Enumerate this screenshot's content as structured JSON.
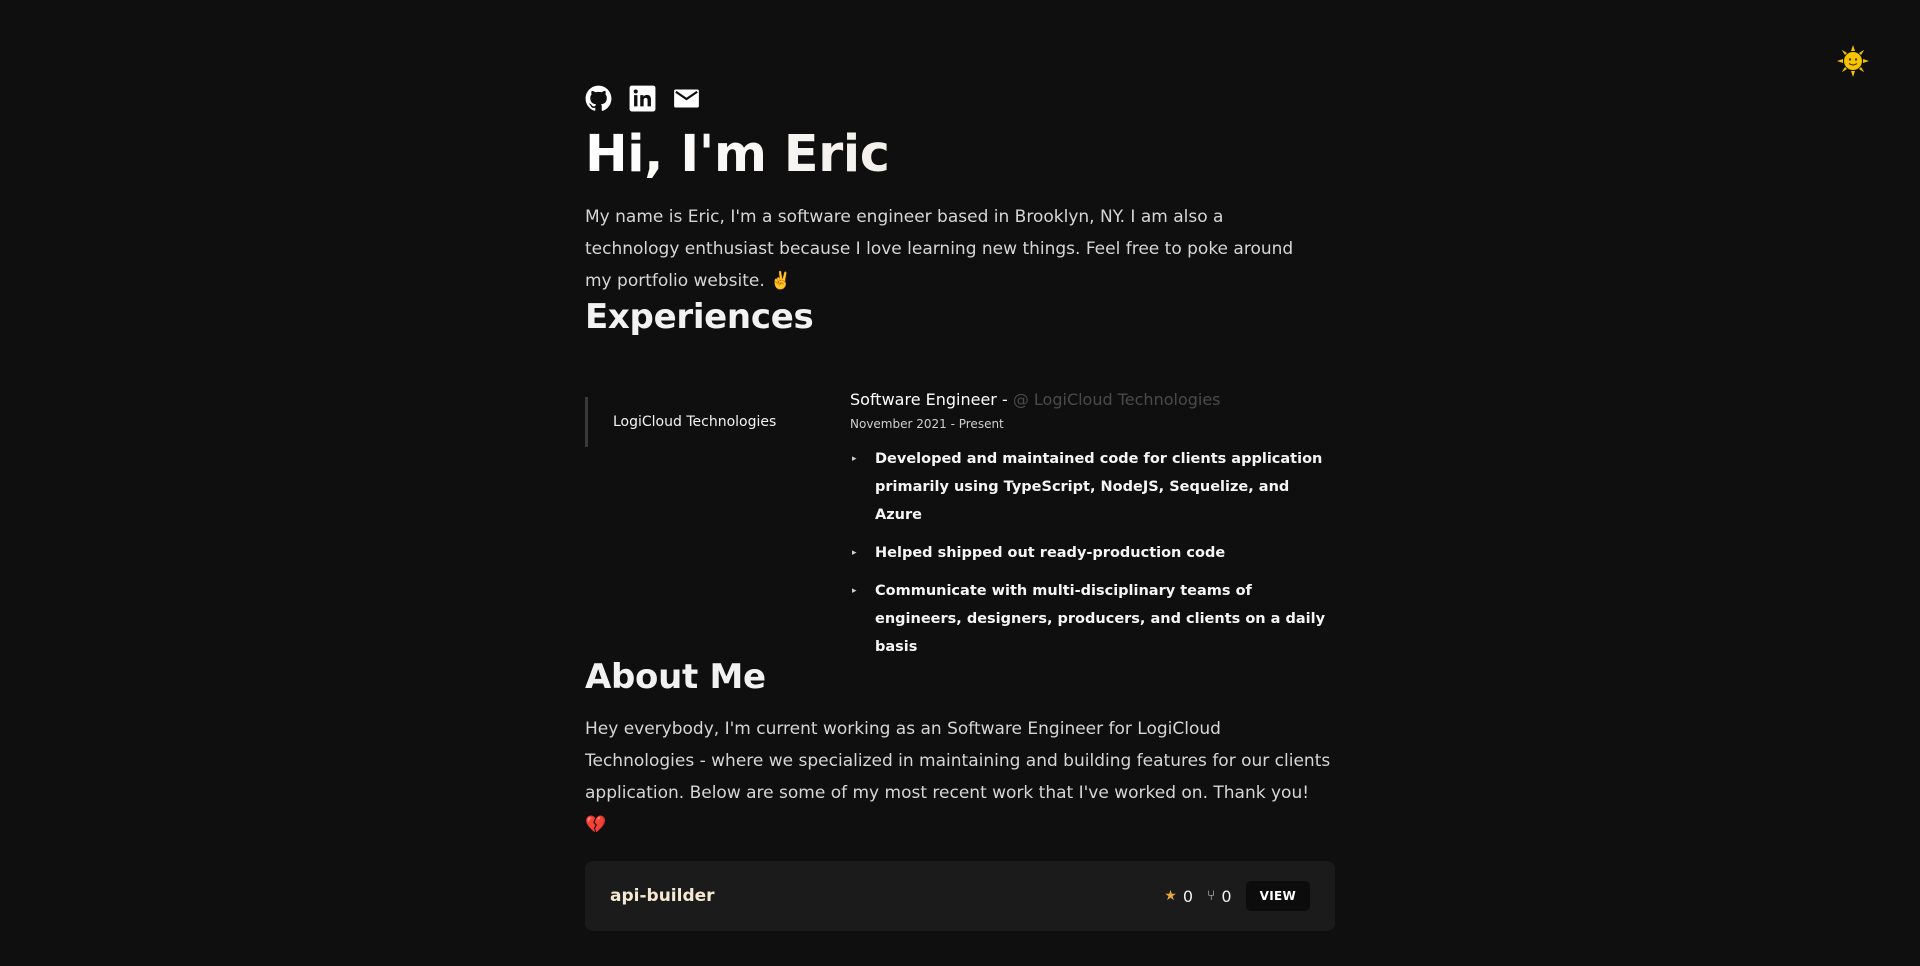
{
  "theme_toggle": {
    "icon": "sun-icon"
  },
  "social": [
    {
      "icon": "github-icon"
    },
    {
      "icon": "linkedin-icon"
    },
    {
      "icon": "mail-icon"
    }
  ],
  "hero": {
    "title": "Hi, I'm Eric",
    "intro": "My name is Eric, I'm a software engineer based in Brooklyn, NY. I am also a technology enthusiast because I love learning new things. Feel free to poke around my portfolio website. ✌️"
  },
  "experiences": {
    "heading": "Experiences",
    "tabs": [
      "LogiCloud Technologies"
    ],
    "role": "Software Engineer - ",
    "company": "@ LogiCloud Technologies",
    "date": "November 2021 - Present",
    "bullets": [
      "Developed and maintained code for clients application primarily using TypeScript, NodeJS, Sequelize, and Azure",
      "Helped shipped out ready-production code",
      "Communicate with multi-disciplinary teams of engineers, designers, producers, and clients on a daily basis"
    ]
  },
  "about": {
    "heading": "About Me",
    "text": "Hey everybody, I'm current working as an Software Engineer for LogiCloud Technologies - where we specialized in maintaining and building features for our clients application. Below are some of my most recent work that I've worked on. Thank you! 💔"
  },
  "repos": [
    {
      "name": "api-builder",
      "stars": "0",
      "forks": "0",
      "view_label": "VIEW"
    }
  ],
  "colors": {
    "background": "#0f0f0f",
    "card": "#1b1b1b",
    "accent_star": "#e5a83b",
    "sun": "#f5c400"
  }
}
